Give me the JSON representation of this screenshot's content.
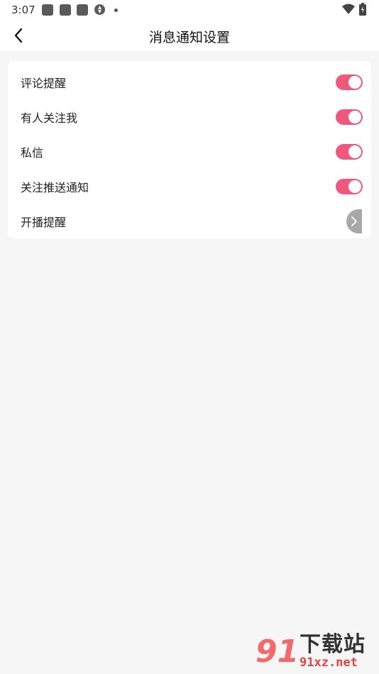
{
  "status_bar": {
    "time": "3:07",
    "notification_icons": [
      "app-icon",
      "app-icon",
      "app-icon",
      "aperture-icon"
    ],
    "right_icons": [
      "wifi-icon",
      "battery-icon"
    ]
  },
  "header": {
    "title": "消息通知设置",
    "back_icon": "chevron-left-icon"
  },
  "settings": {
    "items": [
      {
        "label": "评论提醒",
        "control": "toggle",
        "on": true
      },
      {
        "label": "有人关注我",
        "control": "toggle",
        "on": true
      },
      {
        "label": "私信",
        "control": "toggle",
        "on": true
      },
      {
        "label": "关注推送通知",
        "control": "toggle",
        "on": true
      },
      {
        "label": "开播提醒",
        "control": "chevron",
        "icon": "chevron-right-icon"
      }
    ]
  },
  "watermark": {
    "logo_text": "91",
    "brand": "下载站",
    "url": "91xz.net"
  },
  "colors": {
    "toggle_on": "#f0577c",
    "background": "#f6f6f6",
    "card": "#ffffff",
    "watermark_accent": "#e0463f"
  }
}
